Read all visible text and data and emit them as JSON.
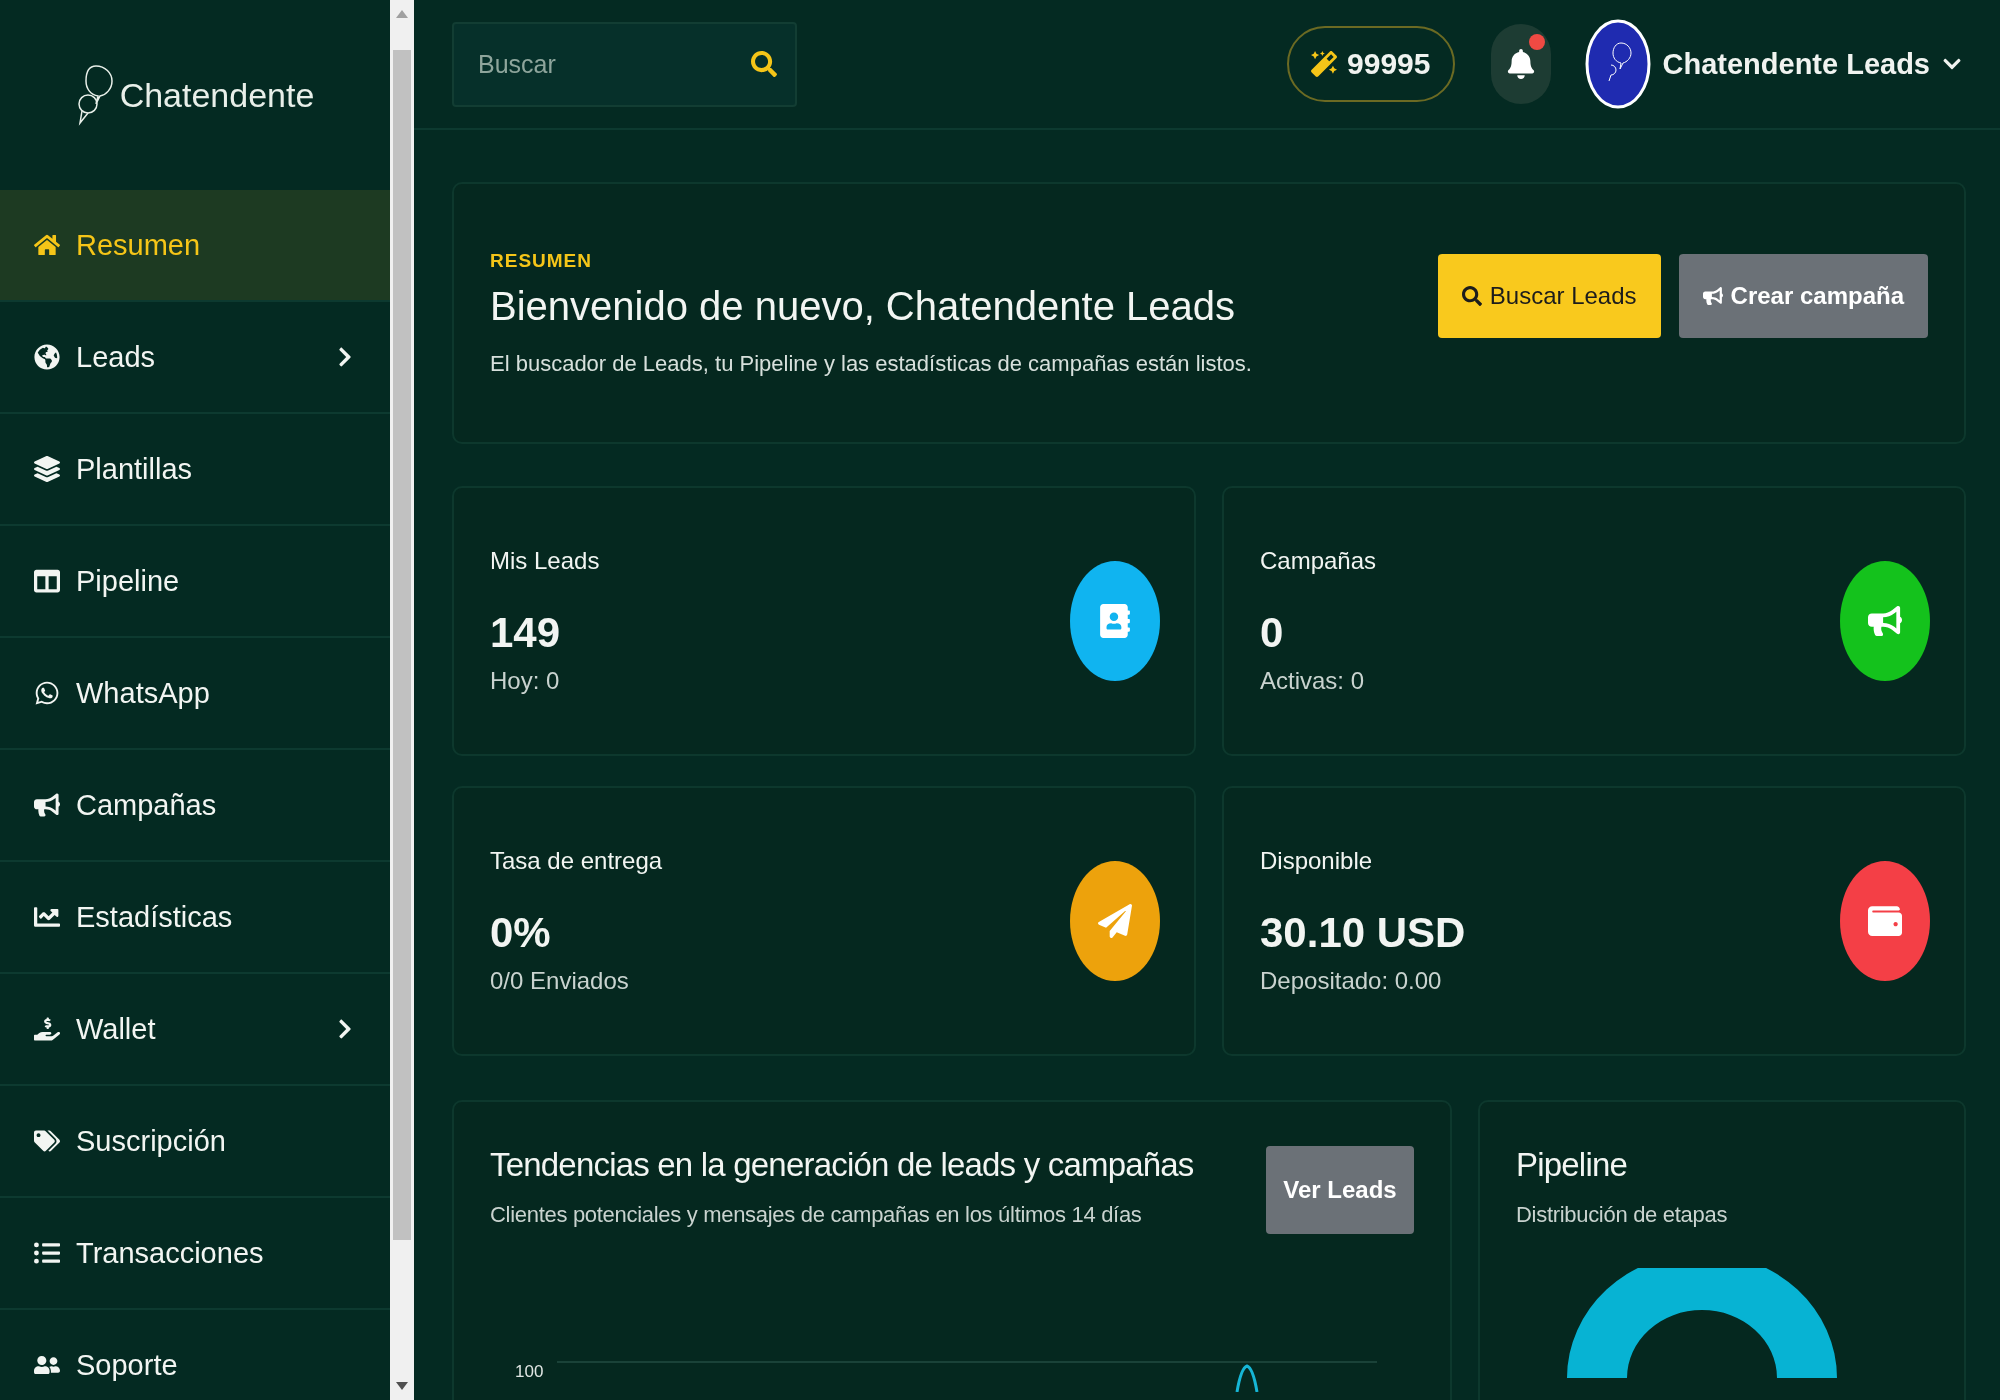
{
  "sidebar": {
    "logo": "Chatendente",
    "items": [
      {
        "label": "Resumen",
        "selected": true,
        "has_submenu": false
      },
      {
        "label": "Leads",
        "selected": false,
        "has_submenu": true
      },
      {
        "label": "Plantillas",
        "selected": false,
        "has_submenu": false
      },
      {
        "label": "Pipeline",
        "selected": false,
        "has_submenu": false
      },
      {
        "label": "WhatsApp",
        "selected": false,
        "has_submenu": false
      },
      {
        "label": "Campañas",
        "selected": false,
        "has_submenu": false
      },
      {
        "label": "Estadísticas",
        "selected": false,
        "has_submenu": false
      },
      {
        "label": "Wallet",
        "selected": false,
        "has_submenu": true
      },
      {
        "label": "Suscripción",
        "selected": false,
        "has_submenu": false
      },
      {
        "label": "Transacciones",
        "selected": false,
        "has_submenu": false
      },
      {
        "label": "Soporte",
        "selected": false,
        "has_submenu": false
      }
    ]
  },
  "header": {
    "search": {
      "placeholder": "Buscar"
    },
    "credits": "99995",
    "notifications": {
      "unread": true
    },
    "user": {
      "name": "Chatendente Leads"
    }
  },
  "hero": {
    "eyebrow": "RESUMEN",
    "title": "Bienvenido de nuevo, Chatendente Leads",
    "subtitle": "El buscador de Leads, tu Pipeline y las estadísticas de campañas están listos.",
    "buttons": [
      {
        "label": "Buscar Leads",
        "kind": "primary"
      },
      {
        "label": "Crear campaña",
        "kind": "secondary"
      }
    ]
  },
  "stats": [
    {
      "label": "Mis Leads",
      "value": "149",
      "detail": "Hoy: 0",
      "color": "#10b4f0"
    },
    {
      "label": "Campañas",
      "value": "0",
      "detail": "Activas: 0",
      "color": "#14c21c"
    },
    {
      "label": "Tasa de entrega",
      "value": "0%",
      "detail": "0/0 Enviados",
      "color": "#eda20c"
    },
    {
      "label": "Disponible",
      "value": "30.10 USD",
      "detail": "Depositado: 0.00",
      "color": "#f43f46"
    }
  ],
  "trends": {
    "title": "Tendencias en la generación de leads y campañas",
    "subtitle": "Clientes potenciales y mensajes de campañas en los últimos 14 días",
    "button": "Ver Leads",
    "y_tick": "100"
  },
  "pipeline": {
    "title": "Pipeline",
    "subtitle": "Distribución de etapas"
  }
}
